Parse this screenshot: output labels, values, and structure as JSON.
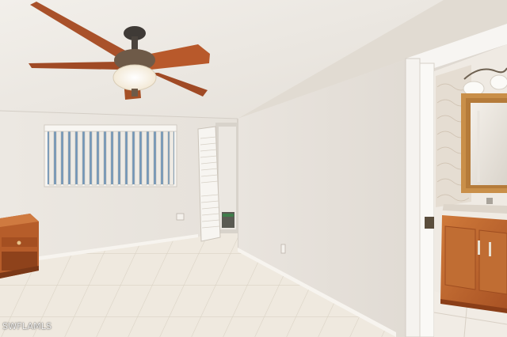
{
  "watermark": {
    "text": "SWFLAMLS"
  }
}
